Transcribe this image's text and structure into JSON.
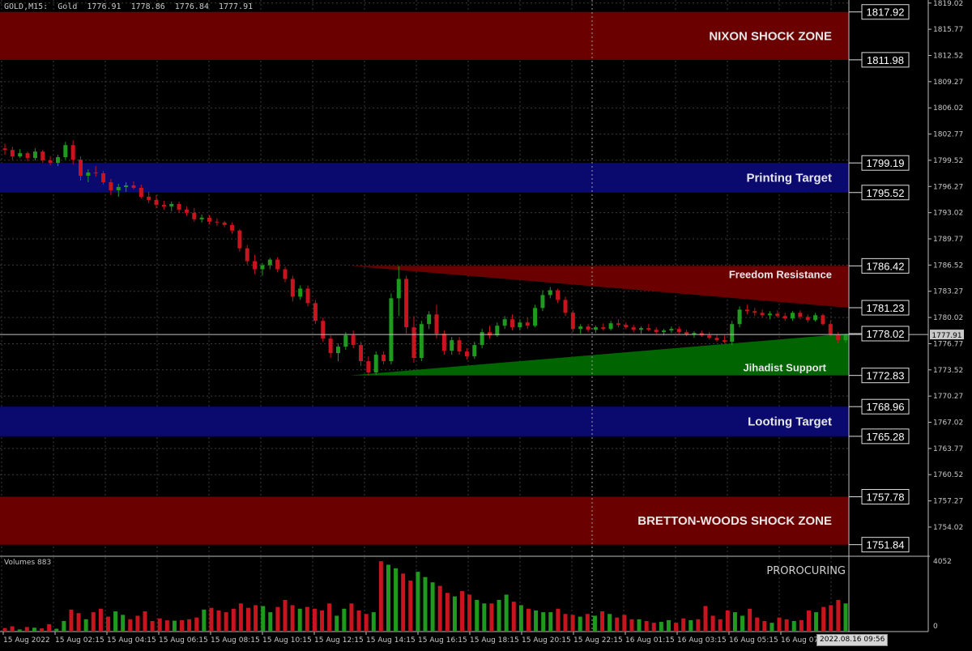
{
  "header": {
    "symbol": "GOLD",
    "timeframe": "M15:",
    "name": "Gold",
    "ohlc": "1776.91  1778.86  1776.84  1777.91"
  },
  "price_axis": {
    "ticks": [
      "1819.02",
      "1815.77",
      "1812.52",
      "1809.27",
      "1806.02",
      "1802.77",
      "1799.52",
      "1796.27",
      "1793.02",
      "1789.77",
      "1786.52",
      "1783.27",
      "1780.02",
      "1776.77",
      "1773.52",
      "1770.27",
      "1767.02",
      "1763.77",
      "1760.52",
      "1757.27",
      "1754.02"
    ],
    "current_price": "1777.91"
  },
  "zones": [
    {
      "label": "NIXON SHOCK ZONE",
      "top_value": "1817.92",
      "bottom_value": "1811.98",
      "color": "#6b0000"
    },
    {
      "label": "Printing Target",
      "top_value": "1799.19",
      "bottom_value": "1795.52",
      "color": "#0a0a6e"
    },
    {
      "label": "Looting Target",
      "top_value": "1768.96",
      "bottom_value": "1765.28",
      "color": "#0a0a6e"
    },
    {
      "label": "BRETTON-WOODS SHOCK ZONE",
      "top_value": "1757.78",
      "bottom_value": "1751.84",
      "color": "#6b0000"
    }
  ],
  "channel": {
    "resistance_label": "Freedom Resistance",
    "support_label": "Jihadist Support",
    "resistance_values": [
      "1786.42",
      "1781.23"
    ],
    "support_values": [
      "1778.02",
      "1772.83"
    ],
    "resistance_color": "#6b0000",
    "support_color": "#006400"
  },
  "volume": {
    "label": "Volumes 883",
    "axis_max": "4052",
    "axis_min": "0",
    "indicator_name": "PROROCURING"
  },
  "time_axis": {
    "labels": [
      "15 Aug 2022",
      "15 Aug 02:15",
      "15 Aug 04:15",
      "15 Aug 06:15",
      "15 Aug 08:15",
      "15 Aug 10:15",
      "15 Aug 12:15",
      "15 Aug 14:15",
      "15 Aug 16:15",
      "15 Aug 18:15",
      "15 Aug 20:15",
      "15 Aug 22:15",
      "16 Aug 01:15",
      "16 Aug 03:15",
      "16 Aug 05:15",
      "16 Aug 07:"
    ],
    "cursor_time": "2022.08.16 09:56"
  },
  "colors": {
    "bull": "#1f9a1f",
    "bear": "#c8141e",
    "grid": "#3a3a3a",
    "text": "#c8c8c8"
  },
  "candles": [
    [
      1801.0,
      1801.6,
      1800.2,
      1800.8
    ],
    [
      1800.8,
      1801.2,
      1799.6,
      1800.0
    ],
    [
      1800.0,
      1800.9,
      1799.8,
      1800.4
    ],
    [
      1800.4,
      1800.6,
      1799.4,
      1799.8
    ],
    [
      1799.8,
      1801.0,
      1799.5,
      1800.6
    ],
    [
      1800.6,
      1800.8,
      1799.2,
      1799.5
    ],
    [
      1799.5,
      1800.0,
      1798.9,
      1799.2
    ],
    [
      1799.2,
      1800.2,
      1798.8,
      1799.9
    ],
    [
      1799.9,
      1801.8,
      1799.6,
      1801.4
    ],
    [
      1801.4,
      1802.0,
      1799.0,
      1799.6
    ],
    [
      1799.6,
      1800.0,
      1797.0,
      1797.6
    ],
    [
      1797.6,
      1798.4,
      1796.8,
      1798.0
    ],
    [
      1798.0,
      1798.8,
      1797.5,
      1797.9
    ],
    [
      1797.9,
      1798.2,
      1796.5,
      1796.8
    ],
    [
      1796.8,
      1797.2,
      1795.2,
      1795.8
    ],
    [
      1795.8,
      1796.6,
      1795.0,
      1796.2
    ],
    [
      1796.2,
      1796.8,
      1795.6,
      1796.4
    ],
    [
      1796.4,
      1796.9,
      1795.9,
      1796.1
    ],
    [
      1796.1,
      1796.5,
      1794.8,
      1795.0
    ],
    [
      1795.0,
      1795.6,
      1794.2,
      1794.6
    ],
    [
      1794.6,
      1795.2,
      1793.6,
      1794.0
    ],
    [
      1794.0,
      1794.5,
      1793.4,
      1793.8
    ],
    [
      1793.8,
      1794.4,
      1793.2,
      1794.1
    ],
    [
      1794.1,
      1794.4,
      1793.0,
      1793.4
    ],
    [
      1793.4,
      1793.8,
      1792.6,
      1793.0
    ],
    [
      1793.0,
      1793.6,
      1791.9,
      1792.2
    ],
    [
      1792.2,
      1792.8,
      1791.8,
      1792.4
    ],
    [
      1792.4,
      1792.7,
      1791.6,
      1791.9
    ],
    [
      1791.9,
      1792.3,
      1791.4,
      1791.8
    ],
    [
      1791.8,
      1792.0,
      1791.2,
      1791.5
    ],
    [
      1791.5,
      1791.8,
      1790.4,
      1790.8
    ],
    [
      1790.8,
      1791.0,
      1788.2,
      1788.6
    ],
    [
      1788.6,
      1789.0,
      1786.6,
      1787.0
    ],
    [
      1787.0,
      1787.8,
      1785.4,
      1786.0
    ],
    [
      1786.0,
      1786.8,
      1785.2,
      1786.5
    ],
    [
      1786.5,
      1787.4,
      1786.0,
      1787.2
    ],
    [
      1787.2,
      1787.5,
      1785.6,
      1786.0
    ],
    [
      1786.0,
      1786.3,
      1784.4,
      1784.8
    ],
    [
      1784.8,
      1785.2,
      1782.0,
      1782.6
    ],
    [
      1782.6,
      1784.0,
      1782.2,
      1783.6
    ],
    [
      1783.6,
      1784.0,
      1781.4,
      1781.8
    ],
    [
      1781.8,
      1782.2,
      1779.2,
      1779.6
    ],
    [
      1779.6,
      1780.0,
      1777.0,
      1777.4
    ],
    [
      1777.4,
      1777.8,
      1775.0,
      1775.6
    ],
    [
      1775.6,
      1776.8,
      1774.6,
      1776.4
    ],
    [
      1776.4,
      1778.2,
      1776.0,
      1777.8
    ],
    [
      1777.8,
      1778.4,
      1776.2,
      1776.6
    ],
    [
      1776.6,
      1777.0,
      1774.0,
      1774.6
    ],
    [
      1774.6,
      1775.2,
      1772.8,
      1773.2
    ],
    [
      1773.2,
      1775.8,
      1772.9,
      1775.4
    ],
    [
      1775.4,
      1775.8,
      1774.2,
      1774.6
    ],
    [
      1774.6,
      1783.0,
      1774.2,
      1782.4
    ],
    [
      1782.4,
      1786.4,
      1780.2,
      1784.8
    ],
    [
      1784.8,
      1785.2,
      1778.0,
      1778.8
    ],
    [
      1778.8,
      1780.2,
      1774.4,
      1775.0
    ],
    [
      1775.0,
      1779.6,
      1774.6,
      1779.2
    ],
    [
      1779.2,
      1780.8,
      1778.6,
      1780.4
    ],
    [
      1780.4,
      1781.6,
      1777.4,
      1778.0
    ],
    [
      1778.0,
      1778.4,
      1775.4,
      1775.9
    ],
    [
      1775.9,
      1777.6,
      1775.4,
      1777.2
    ],
    [
      1777.2,
      1777.6,
      1775.4,
      1775.8
    ],
    [
      1775.8,
      1776.2,
      1774.8,
      1775.2
    ],
    [
      1775.2,
      1777.0,
      1774.9,
      1776.6
    ],
    [
      1776.6,
      1778.6,
      1776.2,
      1778.2
    ],
    [
      1778.2,
      1779.0,
      1777.4,
      1777.8
    ],
    [
      1777.8,
      1779.4,
      1777.6,
      1779.0
    ],
    [
      1779.0,
      1780.2,
      1778.6,
      1779.8
    ],
    [
      1779.8,
      1780.4,
      1778.4,
      1778.8
    ],
    [
      1778.8,
      1779.8,
      1778.4,
      1779.4
    ],
    [
      1779.4,
      1780.0,
      1778.6,
      1779.0
    ],
    [
      1779.0,
      1781.6,
      1778.8,
      1781.2
    ],
    [
      1781.2,
      1783.4,
      1780.8,
      1782.8
    ],
    [
      1782.8,
      1783.8,
      1782.4,
      1783.4
    ],
    [
      1783.4,
      1783.6,
      1781.8,
      1782.2
    ],
    [
      1782.2,
      1782.6,
      1780.2,
      1780.6
    ],
    [
      1780.6,
      1780.9,
      1778.2,
      1778.6
    ],
    [
      1778.6,
      1779.2,
      1778.0,
      1778.9
    ],
    [
      1778.9,
      1779.2,
      1778.2,
      1778.5
    ],
    [
      1778.5,
      1779.0,
      1778.1,
      1778.8
    ],
    [
      1778.8,
      1779.3,
      1778.4,
      1778.6
    ],
    [
      1778.6,
      1779.6,
      1778.4,
      1779.3
    ],
    [
      1779.3,
      1779.8,
      1778.8,
      1779.1
    ],
    [
      1779.1,
      1779.4,
      1778.6,
      1778.8
    ],
    [
      1778.8,
      1779.1,
      1778.2,
      1778.5
    ],
    [
      1778.5,
      1778.9,
      1778.0,
      1778.7
    ],
    [
      1778.7,
      1779.2,
      1778.3,
      1778.5
    ],
    [
      1778.5,
      1778.8,
      1778.0,
      1778.2
    ],
    [
      1778.2,
      1778.6,
      1777.8,
      1778.4
    ],
    [
      1778.4,
      1778.9,
      1778.1,
      1778.6
    ],
    [
      1778.6,
      1778.9,
      1778.0,
      1778.2
    ],
    [
      1778.2,
      1778.5,
      1777.7,
      1777.9
    ],
    [
      1777.9,
      1778.3,
      1777.5,
      1778.1
    ],
    [
      1778.1,
      1778.4,
      1777.6,
      1777.8
    ],
    [
      1777.8,
      1778.2,
      1777.3,
      1777.5
    ],
    [
      1777.5,
      1777.9,
      1777.0,
      1777.2
    ],
    [
      1777.2,
      1777.8,
      1776.8,
      1777.0
    ],
    [
      1777.0,
      1779.6,
      1776.6,
      1779.2
    ],
    [
      1779.2,
      1781.4,
      1778.8,
      1781.0
    ],
    [
      1781.0,
      1781.6,
      1780.4,
      1780.8
    ],
    [
      1780.8,
      1781.2,
      1780.2,
      1780.6
    ],
    [
      1780.6,
      1781.0,
      1780.0,
      1780.3
    ],
    [
      1780.3,
      1780.8,
      1779.8,
      1780.5
    ],
    [
      1780.5,
      1780.9,
      1780.0,
      1780.2
    ],
    [
      1780.2,
      1780.6,
      1779.6,
      1779.9
    ],
    [
      1779.9,
      1780.8,
      1779.6,
      1780.6
    ],
    [
      1780.6,
      1780.9,
      1779.8,
      1780.1
    ],
    [
      1780.1,
      1780.4,
      1779.4,
      1779.7
    ],
    [
      1779.7,
      1780.6,
      1779.5,
      1780.3
    ],
    [
      1780.3,
      1780.5,
      1779.0,
      1779.2
    ],
    [
      1779.2,
      1779.6,
      1777.6,
      1777.9
    ],
    [
      1777.9,
      1778.2,
      1776.8,
      1777.2
    ],
    [
      1777.2,
      1778.0,
      1776.9,
      1777.8
    ]
  ],
  "volumes": [
    200,
    300,
    120,
    260,
    220,
    180,
    420,
    160,
    600,
    1250,
    1050,
    700,
    1100,
    1300,
    850,
    1150,
    950,
    700,
    900,
    1150,
    600,
    750,
    640,
    620,
    650,
    700,
    800,
    1250,
    1350,
    1200,
    1100,
    1300,
    1600,
    1350,
    1500,
    1450,
    1100,
    1400,
    1800,
    1500,
    1300,
    1400,
    1300,
    1200,
    1600,
    900,
    1300,
    1600,
    1200,
    1000,
    1100,
    4000,
    3800,
    3600,
    3300,
    2900,
    3400,
    3100,
    2800,
    2600,
    2200,
    2000,
    2300,
    2100,
    1800,
    1600,
    1600,
    1800,
    2100,
    1700,
    1500,
    1300,
    1200,
    1100,
    1100,
    1300,
    1000,
    950,
    850,
    1000,
    900,
    1150,
    1000,
    800,
    950,
    700,
    700,
    600,
    500,
    550,
    650,
    500,
    750,
    650,
    700,
    1450,
    900,
    700,
    1200,
    1100,
    900,
    1300,
    800,
    600,
    500,
    800,
    700,
    600,
    650,
    1200,
    1100,
    1400,
    1500,
    1800,
    1600
  ]
}
